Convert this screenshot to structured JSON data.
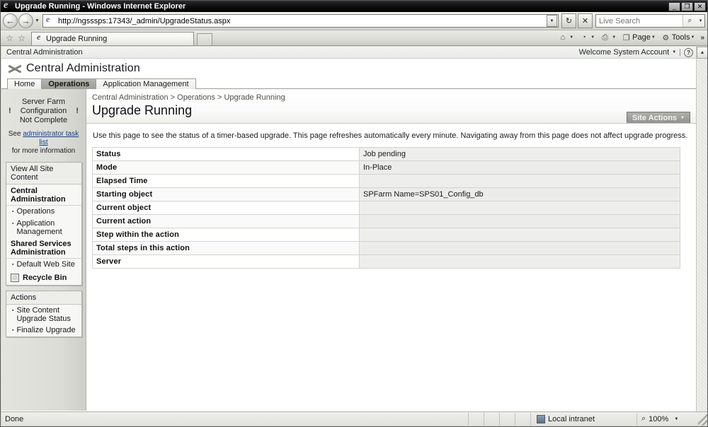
{
  "window": {
    "title": "Upgrade Running - Windows Internet Explorer",
    "minimize_label": "_",
    "restore_label": "❐",
    "close_label": "✕"
  },
  "browser": {
    "back_icon": "←",
    "forward_icon": "→",
    "history_caret": "▼",
    "address_url": "http://ngsssps:17343/_admin/UpgradeStatus.aspx",
    "address_dropdown_caret": "▼",
    "refresh_icon": "↻",
    "stop_icon": "✕",
    "search_value": "",
    "search_placeholder": "Live Search",
    "search_go_icon": "⌕",
    "search_caret": "▼",
    "favorites_add_icon": "☆",
    "favorites_center_icon": "☆",
    "tabs": [
      {
        "label": "Upgrade Running"
      }
    ],
    "new_tab_label": "",
    "command_bar": {
      "home_icon": "⌂",
      "feeds_icon": "◔",
      "print_icon": "⎙",
      "page_label": "Page",
      "page_icon": "❐",
      "tools_label": "Tools",
      "tools_icon": "⚙",
      "overflow_icon": "»",
      "caret": "▼"
    }
  },
  "sharepoint": {
    "global_bar": {
      "site_label": "Central Administration",
      "welcome_text": "Welcome System Account",
      "welcome_caret": "▼",
      "separator": "|",
      "help_icon": "?"
    },
    "site_title": "Central Administration",
    "tabs": [
      {
        "label": "Home",
        "selected": false
      },
      {
        "label": "Operations",
        "selected": true
      },
      {
        "label": "Application Management",
        "selected": false
      }
    ],
    "site_actions": {
      "label": "Site Actions",
      "caret": "▼"
    },
    "breadcrumb": "Central Administration > Operations > Upgrade Running",
    "page_title": "Upgrade Running",
    "description": "Use this page to see the status of a timer-based upgrade. This page refreshes automatically every minute. Navigating away from this page does not affect upgrade progress."
  },
  "leftnav": {
    "farm_warning": {
      "line1": "Server Farm",
      "line2": "Configuration",
      "line3": "Not Complete",
      "warn_icon": "!"
    },
    "see_prefix": "See ",
    "see_link": "administrator task list",
    "see_suffix": "for more information",
    "view_all_site_content": "View All Site Content",
    "groups": [
      {
        "heading": "Central Administration",
        "items": [
          {
            "label": "Operations"
          },
          {
            "label": "Application Management"
          }
        ]
      },
      {
        "heading": "Shared Services Administration",
        "items": [
          {
            "label": "Default Web Site"
          }
        ]
      }
    ],
    "recycle_bin": {
      "label": "Recycle Bin",
      "icon": "□"
    },
    "actions_box": {
      "heading": "Actions",
      "items": [
        {
          "label": "Site Content Upgrade Status"
        },
        {
          "label": "Finalize Upgrade"
        }
      ]
    },
    "bullet": "▪"
  },
  "status_table": {
    "rows": [
      {
        "label": "Status",
        "value": "Job pending"
      },
      {
        "label": "Mode",
        "value": "In-Place"
      },
      {
        "label": "Elapsed Time",
        "value": ""
      },
      {
        "label": "Starting object",
        "value": "SPFarm Name=SPS01_Config_db"
      },
      {
        "label": "Current object",
        "value": ""
      },
      {
        "label": "Current action",
        "value": ""
      },
      {
        "label": "Step within the action",
        "value": ""
      },
      {
        "label": "Total steps in this action",
        "value": ""
      },
      {
        "label": "Server",
        "value": ""
      }
    ]
  },
  "statusbar": {
    "message": "Done",
    "zone_label": "Local intranet",
    "zoom_level": "100%",
    "zoom_icon": "⌕",
    "zoom_caret": "▼"
  }
}
